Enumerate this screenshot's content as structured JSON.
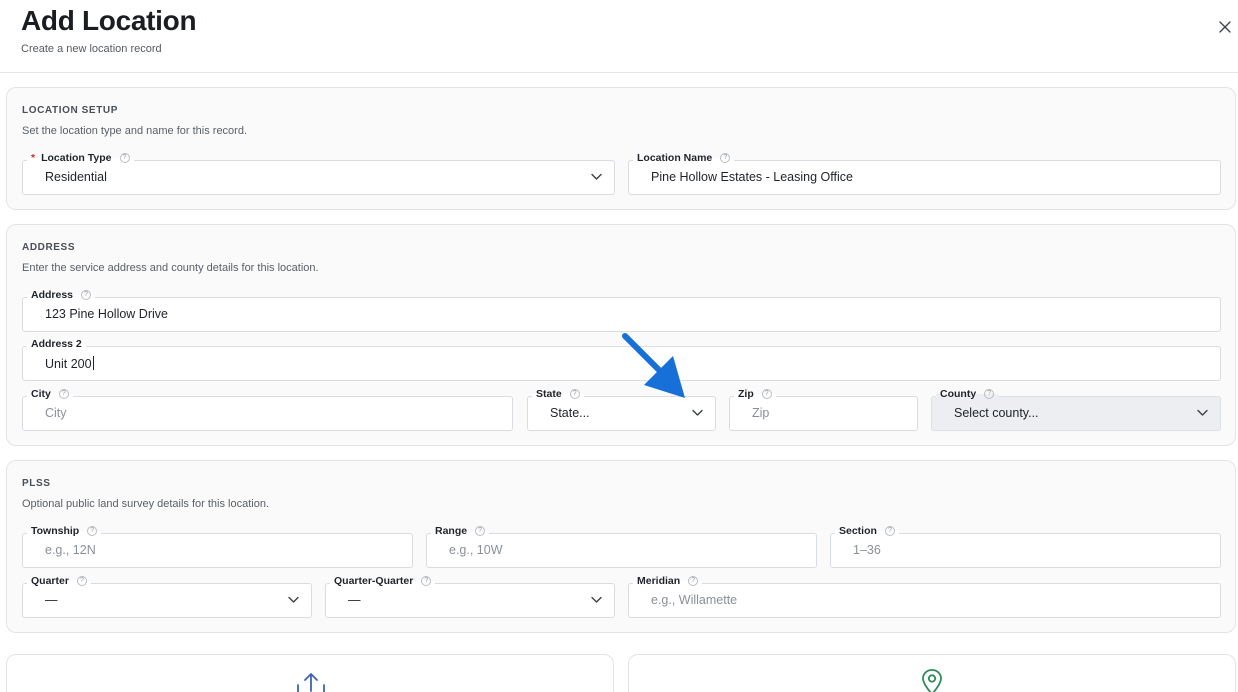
{
  "header": {
    "title": "Add Location",
    "subtitle": "Create a new location record"
  },
  "location_setup": {
    "title": "LOCATION SETUP",
    "description": "Set the location type and name for this record.",
    "location_type": {
      "label": "Location Type",
      "required_mark": "*",
      "value": "Residential"
    },
    "location_name": {
      "label": "Location Name",
      "value": "Pine Hollow Estates - Leasing Office"
    }
  },
  "address": {
    "title": "ADDRESS",
    "description": "Enter the service address and county details for this location.",
    "address1": {
      "label": "Address",
      "value": "123 Pine Hollow Drive"
    },
    "address2": {
      "label": "Address 2",
      "value": "Unit 200"
    },
    "city": {
      "label": "City",
      "placeholder": "City"
    },
    "state": {
      "label": "State",
      "value": "State..."
    },
    "zip": {
      "label": "Zip",
      "placeholder": "Zip"
    },
    "county": {
      "label": "County",
      "value": "Select county..."
    }
  },
  "plss": {
    "title": "PLSS",
    "description": "Optional public land survey details for this location.",
    "township": {
      "label": "Township",
      "placeholder": "e.g., 12N"
    },
    "range": {
      "label": "Range",
      "placeholder": "e.g., 10W"
    },
    "section": {
      "label": "Section",
      "placeholder": "1–36"
    },
    "quarter": {
      "label": "Quarter",
      "value": "—"
    },
    "quarter_quarter": {
      "label": "Quarter-Quarter",
      "value": "—"
    },
    "meridian": {
      "label": "Meridian",
      "placeholder": "e.g., Willamette"
    }
  },
  "icons": {
    "close": "close-icon",
    "help": "help-circle-icon",
    "chevron": "chevron-down-icon",
    "upload": "upload-icon",
    "map_pin": "map-pin-icon",
    "pointer_arrow": "arrow-annotation-icon"
  },
  "colors": {
    "required": "#d1322e",
    "annotation_arrow": "#1670d8",
    "map_pin": "#2f8a5a",
    "upload": "#3a63b8"
  }
}
